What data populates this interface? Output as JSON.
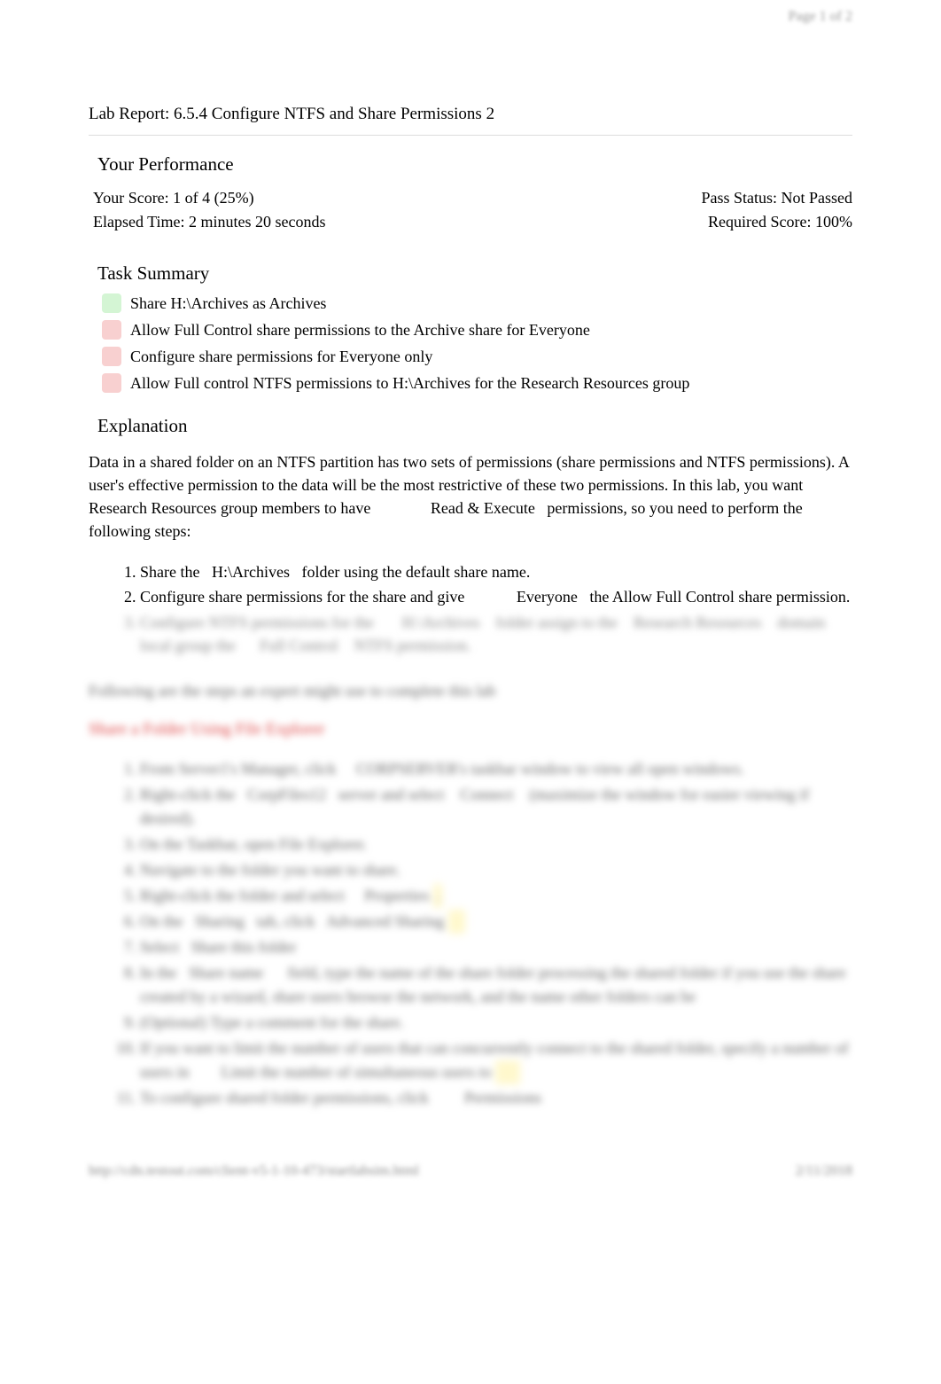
{
  "page_num": "Page 1 of 2",
  "title": "Lab Report: 6.5.4 Configure NTFS and Share Permissions 2",
  "performance": {
    "header": "Your Performance",
    "score": "Your Score: 1 of 4 (25%)",
    "pass_status": "Pass Status: Not Passed",
    "elapsed": "Elapsed Time: 2 minutes 20 seconds",
    "required": "Required Score: 100%"
  },
  "task_summary": {
    "header": "Task Summary",
    "items": [
      {
        "status": "pass",
        "text": "Share H:\\Archives as Archives"
      },
      {
        "status": "fail",
        "text": "Allow Full Control share permissions to the Archive share for Everyone"
      },
      {
        "status": "fail",
        "text": "Configure share permissions for Everyone only"
      },
      {
        "status": "fail",
        "text": "Allow Full control NTFS permissions to H:\\Archives for the Research Resources group"
      }
    ]
  },
  "explanation": {
    "header": "Explanation",
    "para1": "Data in a shared folder on an NTFS partition has two sets of permissions (share permissions and NTFS permissions). A user's effective permission to the data will be the most restrictive of these two permissions. In this lab, you want Research Resources group members to have               Read & Execute   permissions, so you need to perform the following steps:",
    "steps": [
      "Share the   H:\\Archives   folder using the default share name.",
      "Configure share permissions for the share and give             Everyone   the  Allow Full Control   share permission.",
      "Configure NTFS permissions for the       H:\\Archives    folder assign to the    Research Resources    domain local group the      Full Control    NTFS permission."
    ]
  },
  "blurred_intro": "Following are the steps an expert might use to complete this lab",
  "blurred_heading": "Share a Folder Using File Explorer",
  "blurred_steps": [
    "From Server1's Manager, click     CORPSERVER's taskbar window to view all open windows.",
    "Right-click the   CorpFiles12   server and select    Connect    (maximize the window for easier viewing if desired).",
    "On the Taskbar, open File Explorer.",
    "Navigate to the folder you want to share.",
    "Right-click the folder and select     Properties",
    "On the   Sharing   tab, click   Advanced Sharing",
    "Select   Share this folder",
    "In the   Share name      field, type the name of the share folder processing the shared folder if you use the share created by a wizard, share users browse the network, and the name other folders can be",
    "(Optional) Type a comment for the share.",
    "If you want to limit the number of users that can concurrently connect to the shared folder, specify a number of users in        Limit the number of simultaneous users to",
    "To configure shared folder permissions, click         Permissions"
  ],
  "footer_left": "http://cdn.testout.com/client-v5-1-10-473/startlabsim.html",
  "footer_right": "2/11/2018"
}
